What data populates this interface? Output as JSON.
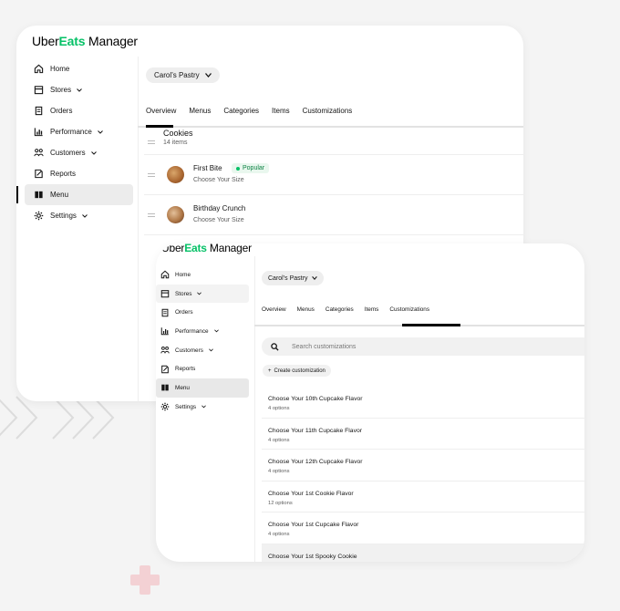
{
  "brand": {
    "uber": "Uber",
    "eats": "Eats",
    "manager": "Manager",
    "accent": "#06c167"
  },
  "sidebar": {
    "items": [
      {
        "label": "Home",
        "icon": "home-icon"
      },
      {
        "label": "Stores",
        "icon": "store-icon",
        "dropdown": true
      },
      {
        "label": "Orders",
        "icon": "orders-icon"
      },
      {
        "label": "Performance",
        "icon": "chart-icon",
        "dropdown": true
      },
      {
        "label": "Customers",
        "icon": "customers-icon",
        "dropdown": true
      },
      {
        "label": "Reports",
        "icon": "reports-icon"
      },
      {
        "label": "Menu",
        "icon": "menu-book-icon",
        "active": true
      },
      {
        "label": "Settings",
        "icon": "gear-icon",
        "dropdown": true
      }
    ]
  },
  "store_selector": {
    "label": "Carol’s Pastry"
  },
  "tabs": [
    "Overview",
    "Menus",
    "Categories",
    "Items",
    "Customizations"
  ],
  "menu_view": {
    "active_tab": "Overview",
    "category": {
      "title": "Cookies",
      "count": "14 items"
    },
    "items": [
      {
        "title": "First Bite",
        "subtitle": "Choose Your Size",
        "badge": "Popular"
      },
      {
        "title": "Birthday Crunch",
        "subtitle": "Choose Your Size"
      }
    ]
  },
  "customizations_view": {
    "active_tab": "Customizations",
    "search_placeholder": "Search customizations",
    "create_label": "Create customization",
    "rows": [
      {
        "title": "Choose Your 10th Cupcake Flavor",
        "sub": "4 options"
      },
      {
        "title": "Choose Your 11th Cupcake Flavor",
        "sub": "4 options"
      },
      {
        "title": "Choose Your 12th Cupcake Flavor",
        "sub": "4 options"
      },
      {
        "title": "Choose Your 1st Cookie Flavor",
        "sub": "12 options"
      },
      {
        "title": "Choose Your 1st Cupcake Flavor",
        "sub": "4 options"
      },
      {
        "title": "Choose Your 1st Spooky Cookie",
        "sub": ""
      }
    ]
  }
}
